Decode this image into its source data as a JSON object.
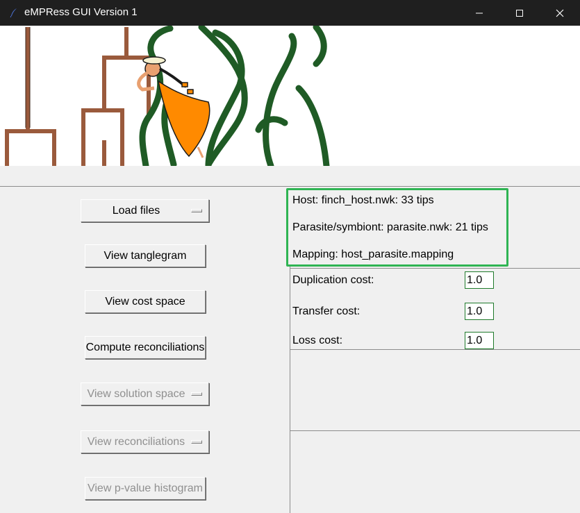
{
  "window": {
    "title": "eMPRess GUI Version 1",
    "controls": {
      "minimize_icon": "minimize-icon",
      "maximize_icon": "maximize-icon",
      "close_icon": "close-icon"
    }
  },
  "banner": {
    "image": "empress-logo-banner-illustration",
    "colors": {
      "tree_brown": "#9a5a3c",
      "vine_green": "#1f5b25",
      "dress_orange": "#ff8a00"
    }
  },
  "buttons": {
    "load_files": "Load files",
    "view_tanglegram": "View tanglegram",
    "view_cost_space": "View cost space",
    "compute_reconciliations": "Compute reconciliations",
    "view_solution_space": "View solution space",
    "view_reconciliations": "View reconciliations",
    "view_pvalue_histogram": "View p-value histogram"
  },
  "info": {
    "host": "Host: finch_host.nwk: 33 tips",
    "parasite": "Parasite/symbiont: parasite.nwk: 21 tips",
    "mapping": "Mapping: host_parasite.mapping"
  },
  "costs": {
    "duplication": {
      "label": "Duplication cost:",
      "value": "1.0"
    },
    "transfer": {
      "label": "Transfer cost:",
      "value": "1.0"
    },
    "loss": {
      "label": "Loss cost:",
      "value": "1.0"
    }
  },
  "colors": {
    "highlight_border": "#2fb453",
    "disabled_text": "#8f8f8f",
    "titlebar": "#1f1f1f"
  }
}
